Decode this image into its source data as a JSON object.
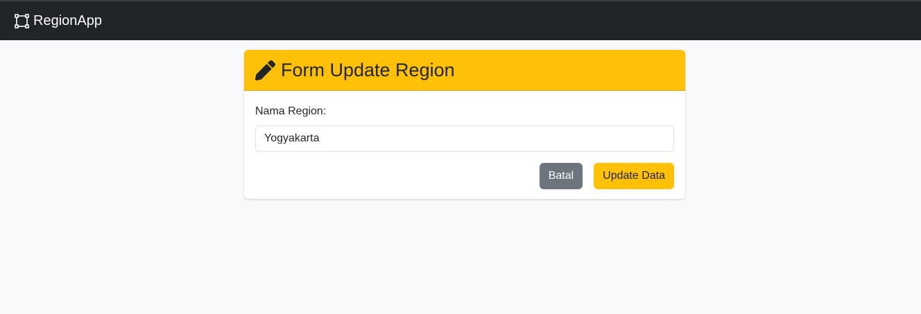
{
  "navbar": {
    "brand_label": "RegionApp",
    "brand_icon": "bounding-box-icon"
  },
  "card": {
    "header_icon": "pencil-icon",
    "title": "Form Update Region",
    "accent_color": "#ffc107"
  },
  "form": {
    "region_label": "Nama Region:",
    "region_value": "Yogyakarta"
  },
  "buttons": {
    "cancel_label": "Batal",
    "cancel_color": "#6c757d",
    "submit_label": "Update Data",
    "submit_color": "#ffc107"
  },
  "colors": {
    "navbar_bg": "#212529",
    "page_bg": "#f8f9fa"
  }
}
